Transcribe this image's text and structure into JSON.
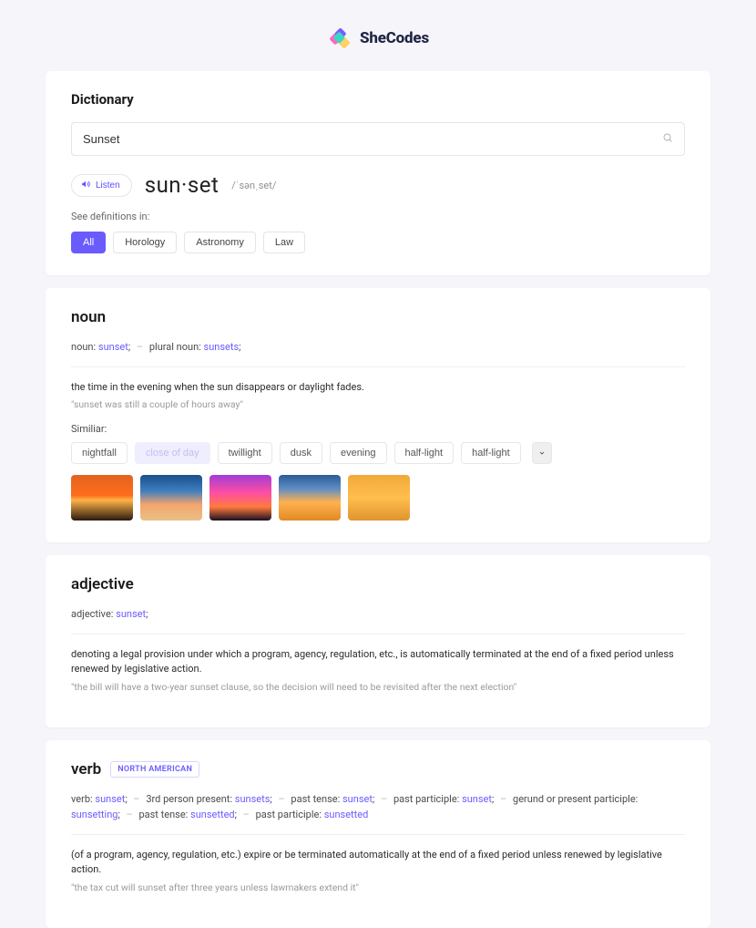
{
  "brand": {
    "name": "SheCodes"
  },
  "header": {
    "title": "Dictionary",
    "search_value": "Sunset",
    "search_placeholder": "Search"
  },
  "word": {
    "listen_label": "Listen",
    "headword": "sun·set",
    "pronunciation": "/ˈsənˌset/",
    "see_in_label": "See definitions in:",
    "filters": [
      "All",
      "Horology",
      "Astronomy",
      "Law"
    ],
    "active_filter": 0
  },
  "entries": [
    {
      "pos": "noun",
      "forms_parts": [
        {
          "t": "noun: "
        },
        {
          "t": "sunset",
          "link": true
        },
        {
          "t": ";"
        },
        {
          "dash": true
        },
        {
          "t": "plural noun: "
        },
        {
          "t": "sunsets",
          "link": true
        },
        {
          "t": ";"
        }
      ],
      "definition": "the time in the evening when the sun disappears or daylight fades.",
      "example": "\"sunset was still a couple of hours away\"",
      "similar_label": "Similiar:",
      "similar": [
        "nightfall",
        "close of day",
        "twillight",
        "dusk",
        "evening",
        "half-light",
        "half-light"
      ],
      "similar_selected": 1,
      "has_images": true
    },
    {
      "pos": "adjective",
      "forms_parts": [
        {
          "t": "adjective: "
        },
        {
          "t": "sunset",
          "link": true
        },
        {
          "t": ";"
        }
      ],
      "definition": "denoting a legal provision under which a program, agency, regulation, etc., is automatically terminated at the end of a fixed period unless renewed by legislative action.",
      "example": "\"the bill will have a two-year sunset clause, so the decision will need to be revisited after the next election\""
    },
    {
      "pos": "verb",
      "badge": "NORTH AMERICAN",
      "forms_parts": [
        {
          "t": "verb: "
        },
        {
          "t": "sunset",
          "link": true
        },
        {
          "t": ";"
        },
        {
          "dash": true
        },
        {
          "t": "3rd person present: "
        },
        {
          "t": "sunsets",
          "link": true
        },
        {
          "t": ";"
        },
        {
          "dash": true
        },
        {
          "t": "past tense: "
        },
        {
          "t": "sunset",
          "link": true
        },
        {
          "t": ";"
        },
        {
          "dash": true
        },
        {
          "t": "past participle: "
        },
        {
          "t": "sunset",
          "link": true
        },
        {
          "t": ";"
        },
        {
          "dash": true
        },
        {
          "t": "gerund or present participle: "
        },
        {
          "t": "sunsetting",
          "link": true
        },
        {
          "t": ";"
        },
        {
          "dash": true
        },
        {
          "t": "past tense: "
        },
        {
          "t": "sunsetted",
          "link": true
        },
        {
          "t": ";"
        },
        {
          "dash": true
        },
        {
          "t": "past participle: "
        },
        {
          "t": "sunsetted",
          "link": true
        }
      ],
      "definition": "(of a program, agency, regulation, etc.) expire or be terminated automatically at the end of a fixed period unless renewed by legislative action.",
      "example": "\"the tax cut will sunset after three years unless lawmakers extend it\""
    }
  ]
}
